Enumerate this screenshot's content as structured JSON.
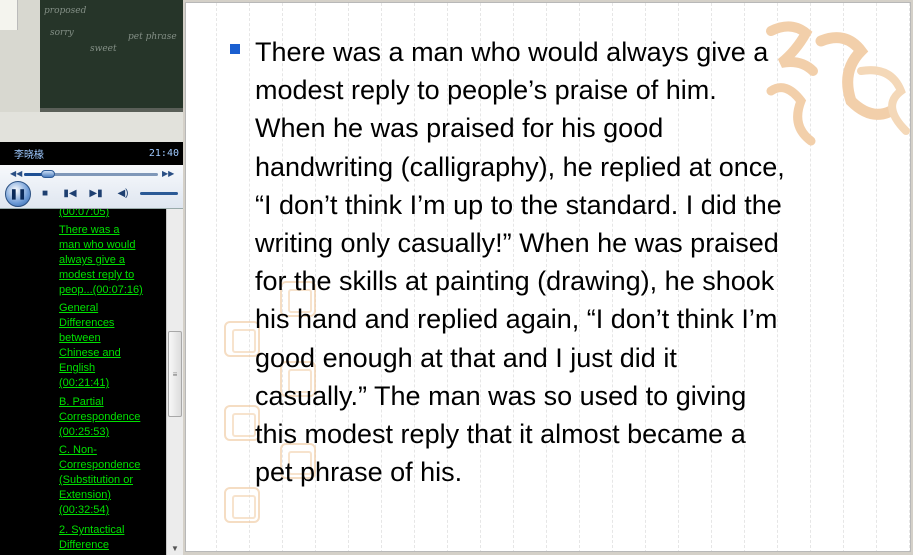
{
  "player": {
    "presenter": "李晓椽",
    "time": "21:40",
    "chalk": [
      "proposed",
      "sorry",
      "pet phrase",
      "sweet"
    ],
    "progress": 0.18,
    "volume": 1.0
  },
  "chapters": [
    {
      "lines": [
        "(00:07:05)"
      ]
    },
    {
      "lines": [
        "There was a",
        "man who would",
        "always give a",
        "modest reply to",
        "peop...(00:07:16)"
      ]
    },
    {
      "lines": [
        "General",
        "Differences",
        "between",
        "Chinese and",
        "English",
        "(00:21:41)"
      ]
    },
    {
      "lines": [
        "B. Partial",
        "Correspondence",
        "(00:25:53)"
      ]
    },
    {
      "lines": [
        "C. Non-",
        "Correspondence",
        "(Substitution or",
        "Extension)",
        "(00:32:54)"
      ]
    },
    {
      "lines": [
        "2. Syntactical",
        "Difference"
      ]
    }
  ],
  "slide": {
    "lines": [
      "There was a man who would always give a",
      "modest reply to people’s praise of him.",
      "When he was praised for his good",
      "handwriting (calligraphy), he replied at once,",
      "“I don’t think I’m up to the standard. I did the",
      "writing only casually!” When he was praised",
      "for the skills at painting (drawing), he shook",
      "his hand and replied again, “I don’t think I’m",
      "good enough at that and I just did it",
      "casually.” The man was so used to giving",
      "this modest reply that it almost became a",
      "pet phrase of his."
    ],
    "bullet_color": "#1a5fd0",
    "watermark_color": "#f2cfaa"
  },
  "icons": {
    "play_pause": "pause-icon",
    "stop": "stop-icon",
    "prev": "previous-icon",
    "next": "next-icon",
    "volume": "volume-icon"
  }
}
